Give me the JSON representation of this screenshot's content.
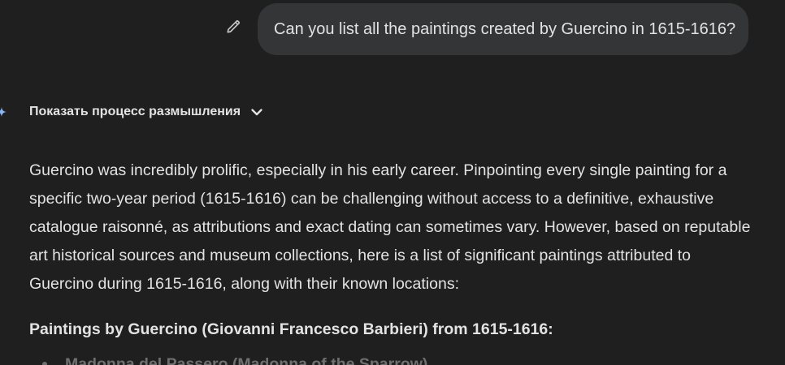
{
  "user_message": {
    "text": "Can you list all the paintings created by Guercino in 1615-1616?",
    "edit_icon": "pencil-icon"
  },
  "thinking": {
    "label": "Показать процесс размышления",
    "icon": "chevron-down-icon"
  },
  "response": {
    "paragraph": "Guercino was incredibly prolific, especially in his early career. Pinpointing every single painting for a specific two-year period (1615-1616) can be challenging without access to a definitive, exhaustive catalogue raisonné, as attributions and exact dating can sometimes vary. However, based on reputable art historical sources and museum collections, here is a list of significant paintings attributed to Guercino during 1615-1616, along with their known locations:",
    "heading": "Paintings by Guercino (Giovanni Francesco Barbieri) from 1615-1616:",
    "items": [
      {
        "label": "Madonna del Passero (Madonna of the Sparrow)"
      }
    ]
  },
  "colors": {
    "background": "#1f1f1f",
    "bubble": "#333537",
    "text": "#e3e3e3",
    "spark": "#8ab4f8"
  }
}
